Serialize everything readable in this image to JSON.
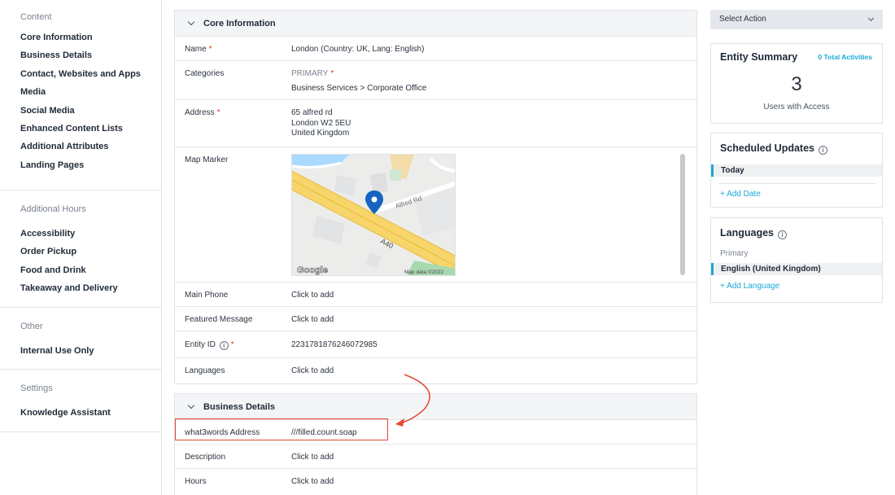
{
  "sidebar": {
    "sections": [
      {
        "title": "Content",
        "items": [
          "Core Information",
          "Business Details",
          "Contact, Websites and Apps",
          "Media",
          "Social Media",
          "Enhanced Content Lists",
          "Additional Attributes",
          "Landing Pages"
        ]
      },
      {
        "title": "Additional Hours",
        "items": [
          "Accessibility",
          "Order Pickup",
          "Food and Drink",
          "Takeaway and Delivery"
        ]
      },
      {
        "title": "Other",
        "items": [
          "Internal Use Only"
        ]
      },
      {
        "title": "Settings",
        "items": [
          "Knowledge Assistant"
        ]
      }
    ]
  },
  "core": {
    "title": "Core Information",
    "name_label": "Name",
    "name_value": "London (Country: UK, Lang: English)",
    "categories_label": "Categories",
    "categories_primary": "PRIMARY",
    "categories_value": "Business Services > Corporate Office",
    "address_label": "Address",
    "address_line1": "65 alfred rd",
    "address_line2": "London W2 5EU",
    "address_line3": "United Kingdom",
    "map_label": "Map Marker",
    "map_street": "Alfred Rd",
    "map_road": "A40",
    "map_logo": "Google",
    "map_credit": "Map data ©2022",
    "phone_label": "Main Phone",
    "featured_label": "Featured Message",
    "entity_id_label": "Entity ID",
    "entity_id_value": "2231781876246072985",
    "languages_label": "Languages",
    "click_to_add": "Click to add",
    "required_mark": "*",
    "info_glyph": "i"
  },
  "business": {
    "title": "Business Details",
    "w3w_label": "what3words Address",
    "w3w_value": "///filled.count.soap",
    "description_label": "Description",
    "hours_label": "Hours",
    "click_to_add": "Click to add"
  },
  "right": {
    "select_action": "Select Action",
    "entity_summary": "Entity Summary",
    "total_activities": "0 Total Activities",
    "users_count": "3",
    "users_label": "Users with Access",
    "scheduled_title": "Scheduled Updates",
    "today": "Today",
    "add_date": "+ Add Date",
    "languages_title": "Languages",
    "primary": "Primary",
    "english": "English (United Kingdom)",
    "add_language": "+ Add Language"
  },
  "colors": {
    "accent": "#1aa9d6",
    "required": "#e0361a",
    "annotation": "#e2462f"
  }
}
